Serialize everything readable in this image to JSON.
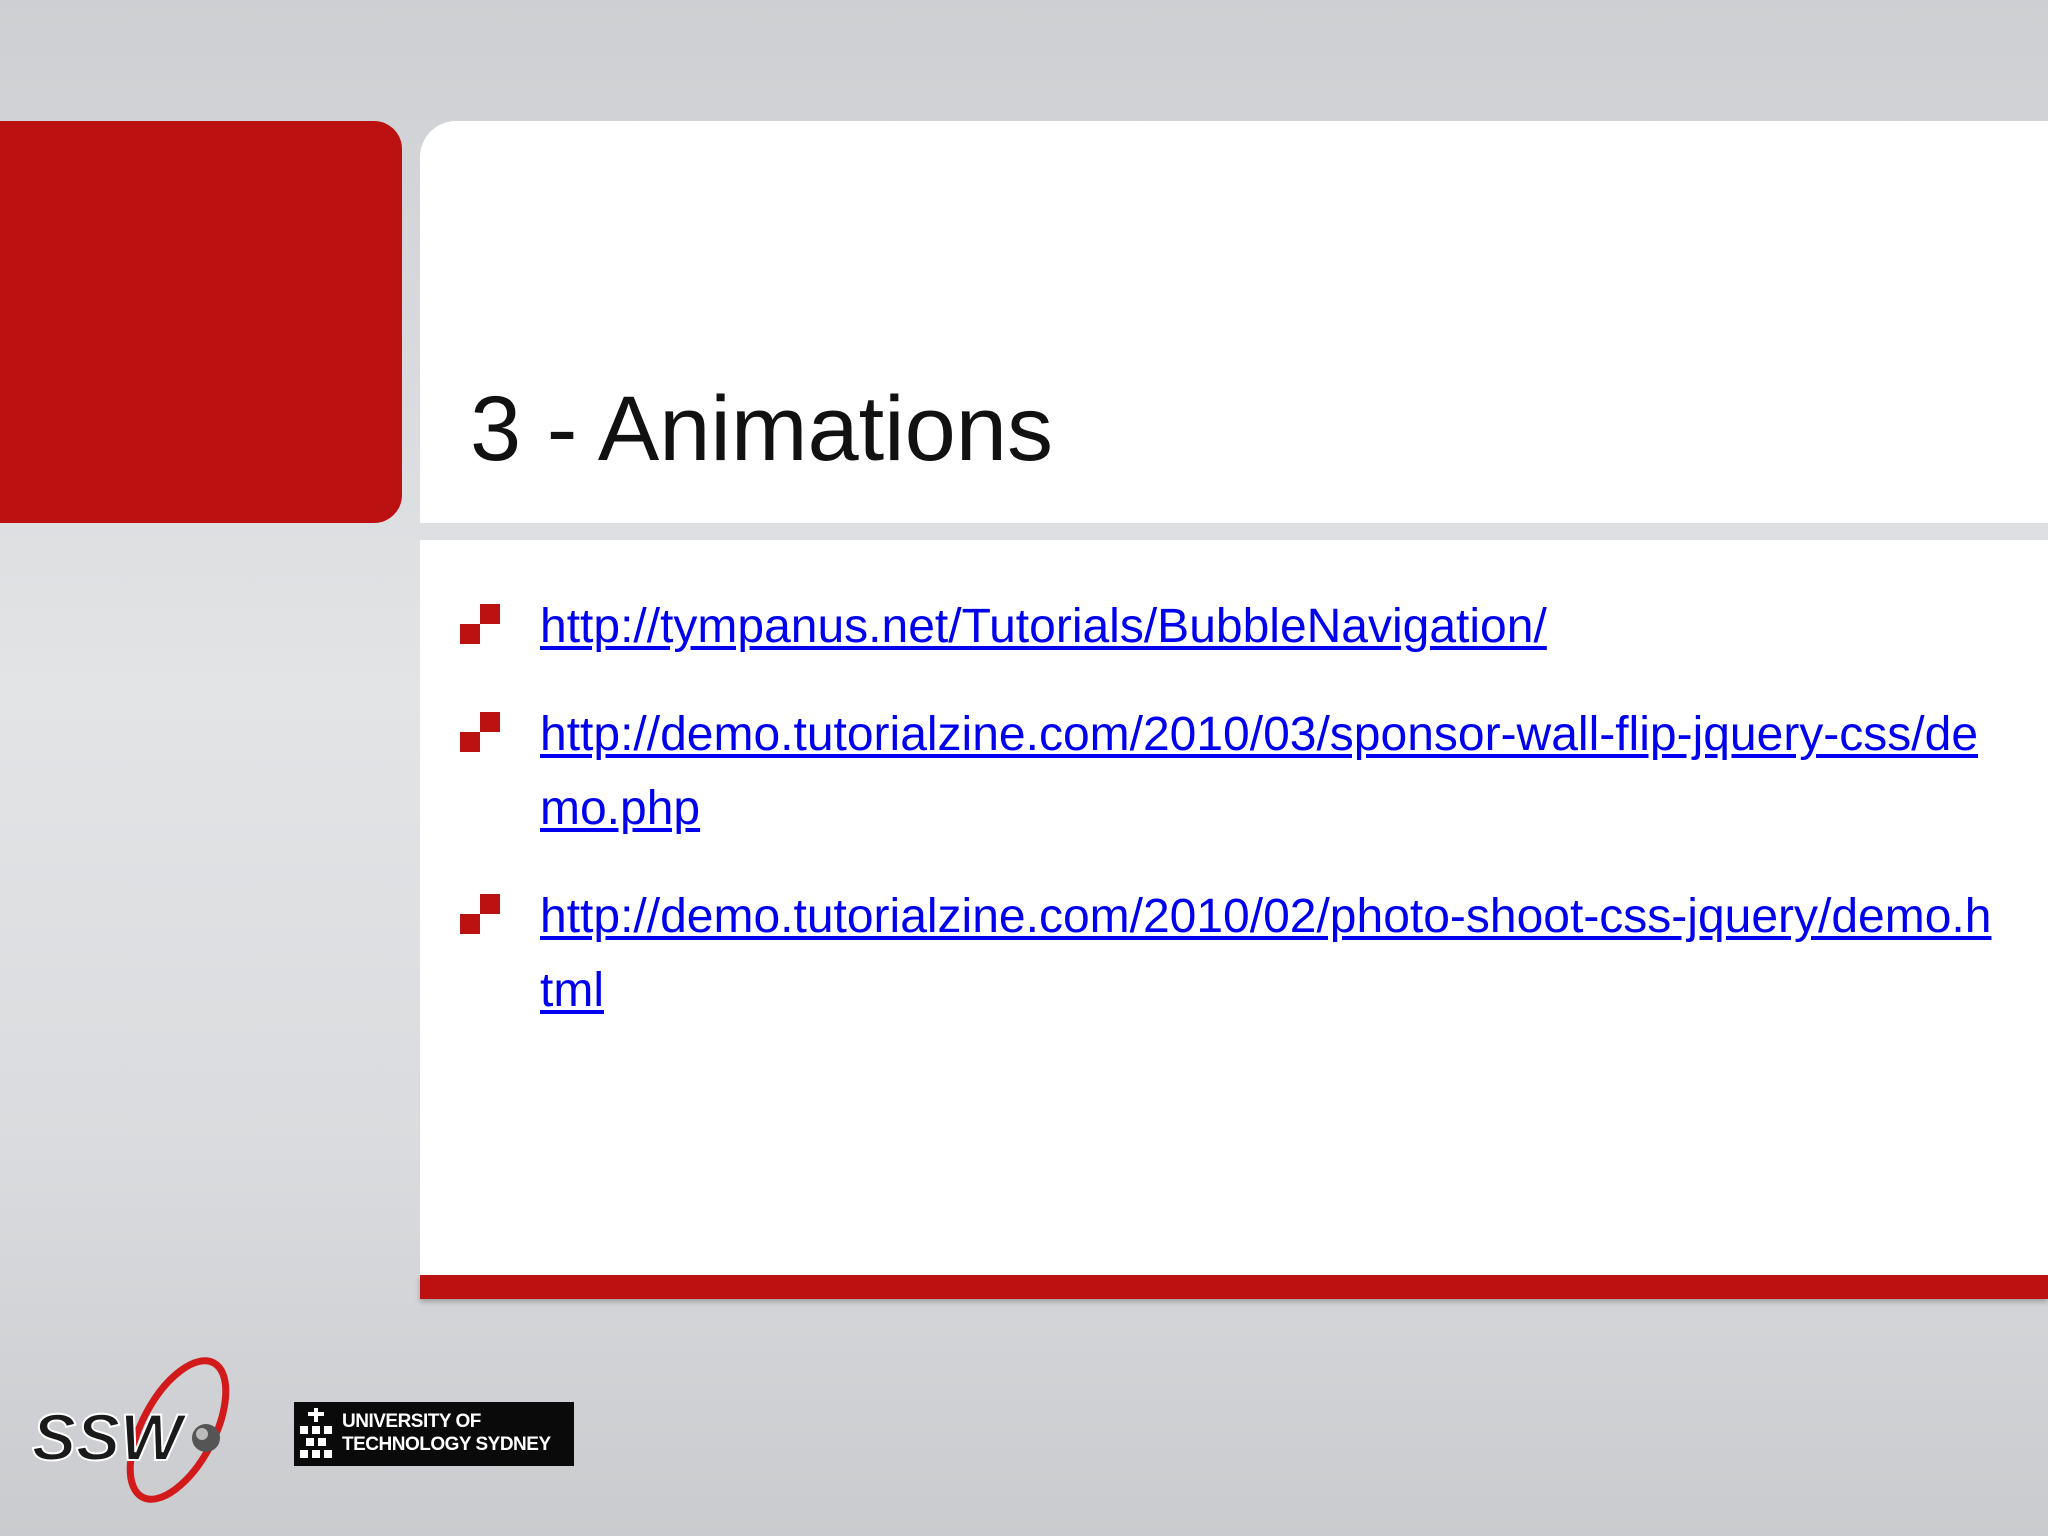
{
  "slide": {
    "title": "3 - Animations",
    "links": [
      "http://tympanus.net/Tutorials/BubbleNavigation/",
      "http://demo.tutorialzine.com/2010/03/sponsor-wall-flip-jquery-css/demo.php",
      "http://demo.tutorialzine.com/2010/02/photo-shoot-css-jquery/demo.html"
    ]
  },
  "footer": {
    "ssw_logo_text": "SSW",
    "uts_line1": "UNIVERSITY OF",
    "uts_line2": "TECHNOLOGY SYDNEY"
  },
  "colors": {
    "accent_red": "#bb1111",
    "link_blue": "#0000ee"
  }
}
